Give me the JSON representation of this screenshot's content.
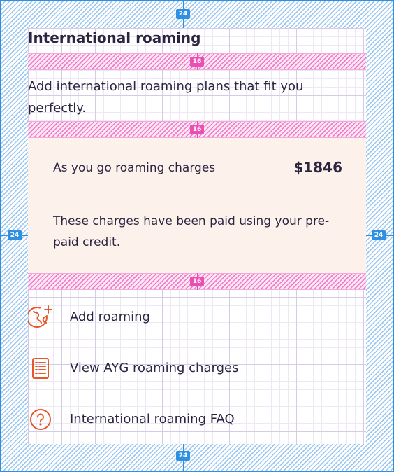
{
  "section": {
    "title": "International roaming",
    "subtitle": "Add international roaming plans that fit you perfectly."
  },
  "charges_card": {
    "title": "As you go roaming charges",
    "amount": "$1846",
    "description": "These charges have been paid using your pre-paid credit."
  },
  "menu": {
    "items": [
      {
        "label": "Add roaming",
        "icon": "globe-plus-icon"
      },
      {
        "label": "View AYG roaming charges",
        "icon": "document-list-icon"
      },
      {
        "label": "International roaming FAQ",
        "icon": "help-circle-icon"
      }
    ]
  },
  "spec_annotations": {
    "outer_top": "24",
    "outer_bottom": "24",
    "outer_left": "24",
    "outer_right": "24",
    "gap_title": "16",
    "gap_subtitle": "16",
    "gap_card": "16"
  },
  "colors": {
    "accent": "#e4582a",
    "text": "#2b2540",
    "card_bg": "#fdf1ec",
    "spec_blue": "#2f8fe0",
    "spec_pink": "#ec4fb3"
  }
}
